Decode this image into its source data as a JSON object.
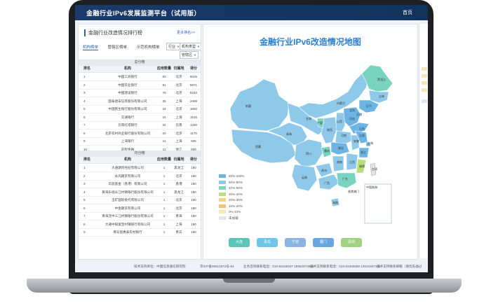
{
  "app": {
    "title": "金融行业IPv6发展监测平台（试用版）",
    "nav_home": "首页"
  },
  "left_panel": {
    "title": "金融行业改造情况排行榜",
    "more_link": "更多排名>>",
    "tabs": [
      "机构榜单",
      "管辖区榜单",
      "示范机构榜单"
    ],
    "filters": {
      "industry": "行业",
      "institution_type": "机构类型",
      "jurisdiction": "管辖区"
    },
    "section1_title": "总分榜",
    "section2_title": "均分榜",
    "columns": [
      "排名",
      "机构",
      "应用数量",
      "归属地",
      "得分"
    ],
    "top_rows": [
      [
        "1",
        "中国工商银行",
        "83",
        "北京",
        "6025"
      ],
      [
        "2",
        "中国农业银行",
        "81",
        "北京",
        "5971"
      ],
      [
        "3",
        "中国建设银行",
        "79",
        "北京",
        "5340"
      ],
      [
        "4",
        "国泰君安证券股份有限公司",
        "25",
        "上海",
        "2489"
      ],
      [
        "5",
        "中国民生银行股份有限公司",
        "19",
        "北京",
        "1860"
      ],
      [
        "6",
        "交通银行",
        "15",
        "上海",
        "1515"
      ],
      [
        "7",
        "云南红塔银行",
        "22",
        "云南",
        "1330"
      ],
      [
        "8",
        "北京农村商业银行股份有限公司",
        "20",
        "北京",
        "1170"
      ],
      [
        "9",
        "上海银行",
        "11",
        "上海",
        "965"
      ],
      [
        "10",
        "前程金融",
        "11",
        "浙江",
        "850"
      ]
    ],
    "avg_rows": [
      [
        "1",
        "大通期货经纪有限公司",
        "1",
        "黑龙江",
        "180"
      ],
      [
        "2",
        "永兆期货有限公司",
        "1",
        "北京",
        "180"
      ],
      [
        "3",
        "华宸基金（香港）有限公司",
        "1",
        "香港",
        "180"
      ],
      [
        "4",
        "黄海乐视长江村镇银行股份有限公司",
        "1",
        "黑龙江",
        "180"
      ],
      [
        "5",
        "玉矿国际投托有限公司",
        "1",
        "北京",
        "180"
      ],
      [
        "6",
        "中金期货有限公司",
        "1",
        "北京",
        "180"
      ],
      [
        "7",
        "青海湟中三江村镇银行股份有限公司",
        "1",
        "青海",
        "180"
      ],
      [
        "8",
        "大通中银富宝村镇银行有限公司",
        "1",
        "上海",
        "180"
      ],
      [
        "9",
        "青岛恩惠泰农村银行",
        "1",
        "青岛",
        "180"
      ]
    ]
  },
  "map": {
    "title": "金融行业IPv6改造情况地图",
    "province_labels": [
      "新疆",
      "西藏",
      "青海",
      "甘肃",
      "内蒙古",
      "黑龙江",
      "吉林",
      "辽宁",
      "北京",
      "天津",
      "河北",
      "山西",
      "陕西",
      "宁夏",
      "山东",
      "河南",
      "四川",
      "重庆",
      "湖北",
      "安徽",
      "江苏",
      "上海",
      "浙江",
      "湖南",
      "江西",
      "福建",
      "云南",
      "贵州",
      "广西",
      "广东",
      "台湾",
      "海南"
    ],
    "special_labels": [
      "中国南海",
      "香港澳门"
    ],
    "legend": [
      {
        "label": "80%-100%",
        "color": "#6cb4e4"
      },
      {
        "label": "50%-80%",
        "color": "#8fc9ea"
      },
      {
        "label": "40%-50%",
        "color": "#78d4c0"
      },
      {
        "label": "30%-40%",
        "color": "#b7e07a"
      },
      {
        "label": "20%-30%",
        "color": "#f3d77a"
      },
      {
        "label": "10%-20%",
        "color": "#f6c07a"
      },
      {
        "label": "0%-10%",
        "color": "#f9e7b4"
      },
      {
        "label": "未加载",
        "color": "#e4e4e4"
      }
    ],
    "city_buttons": [
      {
        "label": "大连",
        "color": "#5cc5b8"
      },
      {
        "label": "青岛",
        "color": "#6ec7e6"
      },
      {
        "label": "宁波",
        "color": "#8db3e2"
      },
      {
        "label": "厦门",
        "color": "#68a7de"
      },
      {
        "label": "深圳",
        "color": "#9fd383"
      }
    ]
  },
  "footer": {
    "support_unit": "技术支持单位：中国信息通信研究院",
    "icp": "京ICP备09013372号-64",
    "business_contact": "业务咨询联系电话：010-65166537 18962973519",
    "tech_contact": "技术支持联系电话：010-62300059 13910367192",
    "tech_email": "技术支持联系邮箱（请优先通过"
  }
}
